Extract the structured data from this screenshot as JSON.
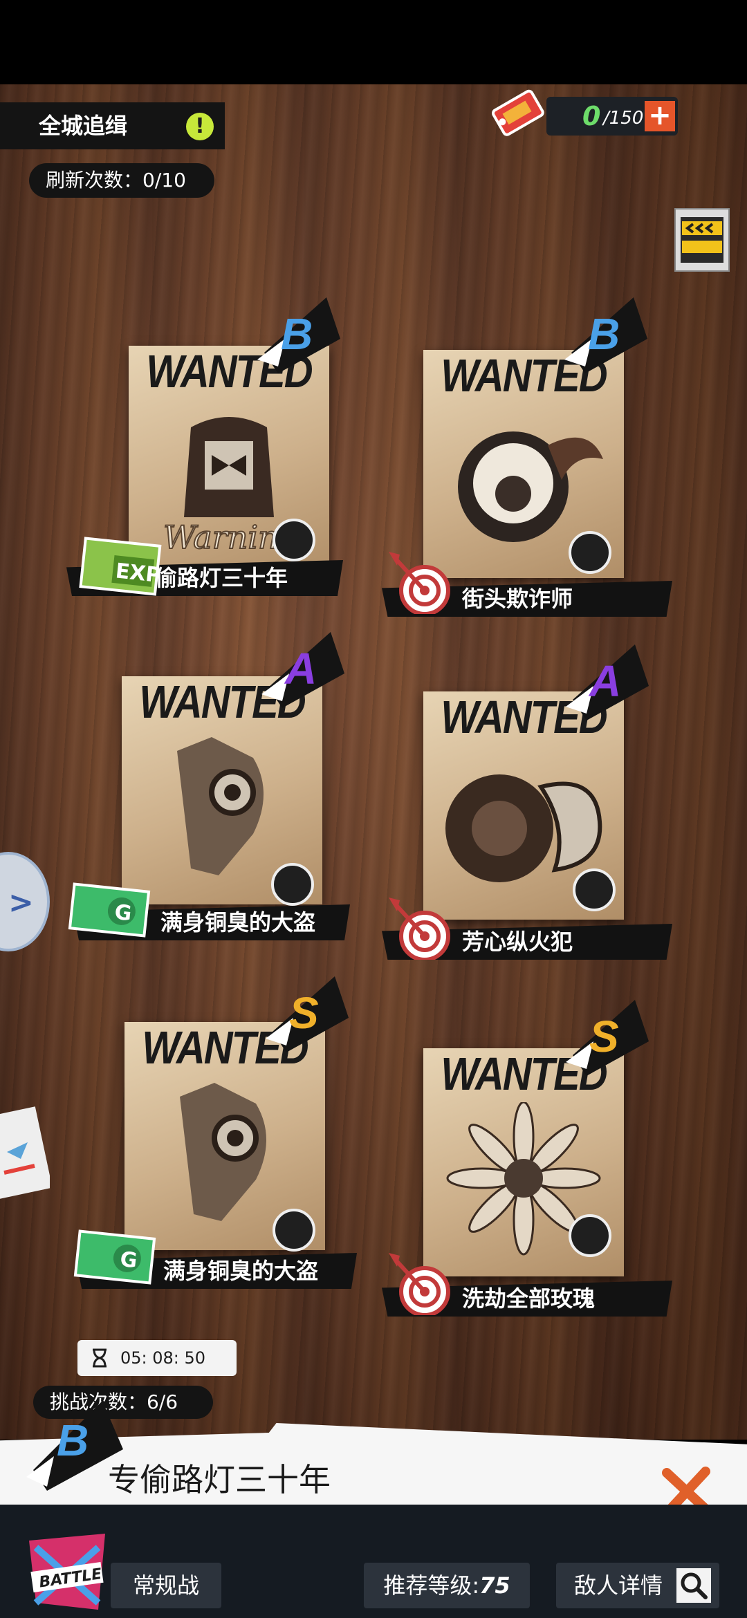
{
  "header": {
    "mode_title": "全城追缉",
    "alert_icon": "exclamation-icon",
    "refresh_label": "刷新次数：0/10"
  },
  "currency": {
    "current": "0",
    "max": "/150",
    "add_label": "+"
  },
  "cards": [
    {
      "grade": "B",
      "grade_color": "#4aa0e8",
      "poster_text": "WANTED",
      "name": "专偷路灯三十年",
      "badge": "exp-ticket-icon",
      "art": "siren-light"
    },
    {
      "grade": "B",
      "grade_color": "#4aa0e8",
      "poster_text": "WANTED",
      "name": "街头欺诈师",
      "badge": "dart-target-icon",
      "art": "swirl-eye"
    },
    {
      "grade": "A",
      "grade_color": "#8a3ee0",
      "poster_text": "WANTED",
      "name": "满身铜臭的大盗",
      "badge": "green-ticket-icon",
      "art": "plague-mask"
    },
    {
      "grade": "A",
      "grade_color": "#8a3ee0",
      "poster_text": "WANTED",
      "name": "芳心纵火犯",
      "badge": "dart-target-icon",
      "art": "tire-smoke"
    },
    {
      "grade": "S",
      "grade_color": "#f0b02a",
      "poster_text": "WANTED",
      "name": "满身铜臭的大盗",
      "badge": "green-ticket-icon",
      "art": "plague-mask"
    },
    {
      "grade": "S",
      "grade_color": "#f0b02a",
      "poster_text": "WANTED",
      "name": "洗劫全部玫瑰",
      "badge": "dart-target-icon",
      "art": "daisy"
    }
  ],
  "challenge": {
    "timer": "05: 08: 50",
    "count_label": "挑战次数：6/6"
  },
  "selected": {
    "grade": "B",
    "name": "专偷路灯三十年"
  },
  "footer": {
    "battle_logo_text": "BATTLE",
    "mode_button": "常规战",
    "level_label": "推荐等级:",
    "level_value": "75",
    "detail_button": "敌人详情"
  }
}
